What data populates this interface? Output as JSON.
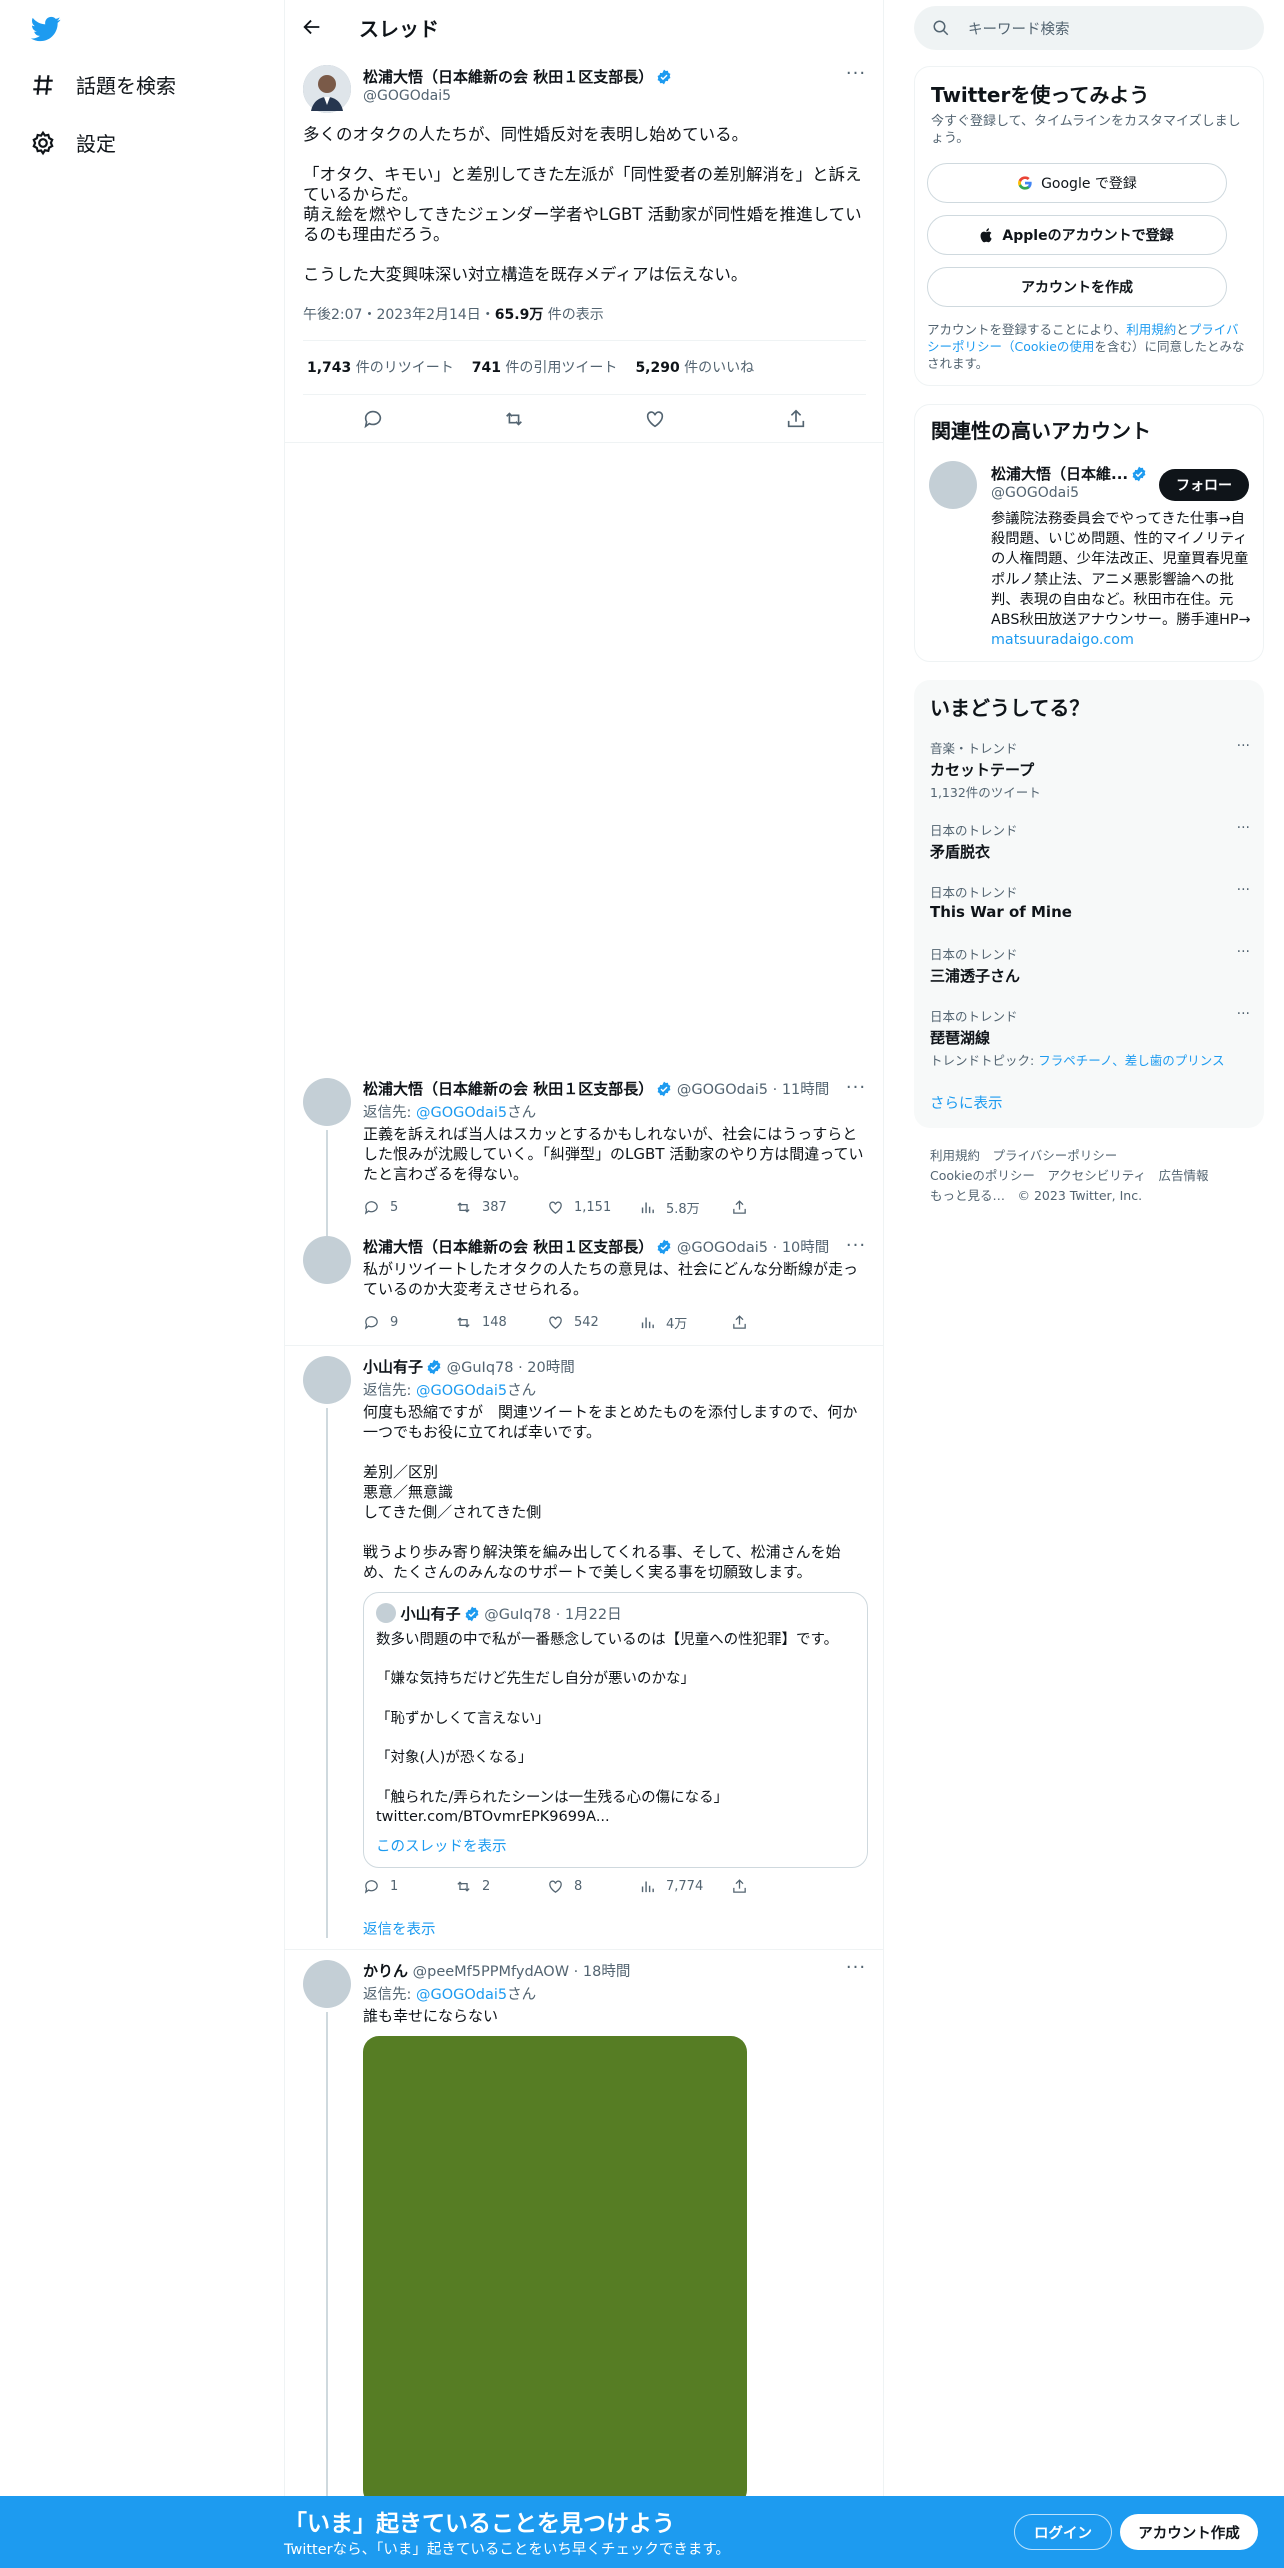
{
  "nav": {
    "explore_label": "話題を検索",
    "settings_label": "設定"
  },
  "header": {
    "title": "スレッド"
  },
  "focus_tweet": {
    "name": "松浦大悟（日本維新の会 秋田１区支部長）",
    "handle": "@GOGOdai5",
    "paragraphs": [
      "多くのオタクの人たちが、同性婚反対を表明し始めている。",
      "「オタク、キモい」と差別してきた左派が「同性愛者の差別解消を」と訴えているからだ。\n萌え絵を燃やしてきたジェンダー学者やLGBT 活動家が同性婚を推進しているのも理由だろう。",
      "こうした大変興味深い対立構造を既存メディアは伝えない。"
    ],
    "time": "午後2:07・2023年2月14日・",
    "views_count": "65.9万",
    "views_label": " 件の表示",
    "retweets_count": "1,743",
    "retweets_label": " 件のリツイート",
    "quotes_count": "741",
    "quotes_label": " 件の引用ツイート",
    "likes_count": "5,290",
    "likes_label": " 件のいいね"
  },
  "replies": [
    {
      "name": "松浦大悟（日本維新の会 秋田１区支部長）",
      "handle_time": "@GOGOdai5 · 11時間",
      "reply_to_prefix": "返信先: ",
      "reply_to_handle": "@GOGOdai5",
      "reply_to_suffix": "さん",
      "text": "正義を訴えれば当人はスカッとするかもしれないが、社会にはうっすらとした恨みが沈殿していく。「糾弾型」のLGBT 活動家のやり方は間違っていたと言わざるを得ない。",
      "replies": "5",
      "retweets": "387",
      "likes": "1,151",
      "views": "5.8万"
    },
    {
      "name": "松浦大悟（日本維新の会 秋田１区支部長）",
      "handle_time": "@GOGOdai5 · 10時間",
      "text": "私がリツイートしたオタクの人たちの意見は、社会にどんな分断線が走っているのか大変考えさせられる。",
      "replies": "9",
      "retweets": "148",
      "likes": "542",
      "views": "4万"
    },
    {
      "name": "小山有子",
      "handle_time": "@GuIq78 · 20時間",
      "reply_to_prefix": "返信先: ",
      "reply_to_handle": "@GOGOdai5",
      "reply_to_suffix": "さん",
      "text": "何度も恐縮ですが　関連ツイートをまとめたものを添付しますので、何か一つでもお役に立てれば幸いです。\n\n差別／区別\n悪意／無意識\nしてきた側／されてきた側\n\n戦うより歩み寄り解決策を編み出してくれる事、そして、松浦さんを始め、たくさんのみんなのサポートで美しく実る事を切願致します。",
      "quote": {
        "name": "小山有子",
        "handle_time": "@GuIq78 · 1月22日",
        "text": "数多い問題の中で私が一番懸念しているのは【児童への性犯罪】です。\n\n「嫌な気持ちだけど先生だし自分が悪いのかな」\n\n「恥ずかしくて言えない」\n\n「対象(人)が恐くなる」\n\n「触られた/弄られたシーンは一生残る心の傷になる」\ntwitter.com/BTOvmrEPK9699A...",
        "show_thread": "このスレッドを表示"
      },
      "replies": "1",
      "retweets": "2",
      "likes": "8",
      "views": "7,774",
      "show_replies": "返信を表示"
    },
    {
      "name": "かりん",
      "handle_time": "@peeMf5PPMfydAOW · 18時間",
      "reply_to_prefix": "返信先: ",
      "reply_to_handle": "@GOGOdai5",
      "reply_to_suffix": "さん",
      "text": "誰も幸せにならない",
      "image_color": "#567d24"
    }
  ],
  "sidebar": {
    "search_placeholder": "キーワード検索",
    "signup_card": {
      "title": "Twitterを使ってみよう",
      "subtitle": "今すぐ登録して、タイムラインをカスタマイズしましょう。",
      "google_button": "Google で登録",
      "apple_button": "Appleのアカウントで登録",
      "create_button": "アカウントを作成",
      "terms_1": "アカウントを登録することにより、",
      "terms_link1": "利用規約",
      "terms_2": "と",
      "terms_link2": "プライバシーポリシー（Cookieの使用",
      "terms_3": "を含む）に同意したとみなされます。"
    },
    "relevant": {
      "title": "関連性の高いアカウント",
      "name": "松浦大悟（日本維...",
      "handle": "@GOGOdai5",
      "follow_label": "フォロー",
      "bio": "参議院法務委員会でやってきた仕事→自殺問題、いじめ問題、性的マイノリティの人権問題、少年法改正、児童買春児童ポルノ禁止法、アニメ悪影響論への批判、表現の自由など。秋田市在住。元ABS秋田放送アナウンサー。勝手連HP→ ",
      "bio_link": "matsuuradaigo.com"
    },
    "trends": {
      "title": "いまどうしてる？",
      "items": [
        {
          "category": "音楽・トレンド",
          "topic": "カセットテープ",
          "sub": "1,132件のツイート"
        },
        {
          "category": "日本のトレンド",
          "topic": "矛盾脱衣",
          "sub": ""
        },
        {
          "category": "日本のトレンド",
          "topic": "This War of Mine",
          "sub": ""
        },
        {
          "category": "日本のトレンド",
          "topic": "三浦透子さん",
          "sub": ""
        },
        {
          "category": "日本のトレンド",
          "topic": "琵琶湖線",
          "sub": ""
        }
      ],
      "last_trend_prefix": "トレンドトピック: ",
      "last_trend_links": "フラペチーノ、差し歯のプリンス",
      "show_more": "さらに表示"
    },
    "footer": {
      "line1": "利用規約　プライバシーポリシー",
      "line2": "Cookieのポリシー　アクセシビリティ　広告情報",
      "line3": "もっと見る…　© 2023 Twitter, Inc."
    }
  },
  "bottom_bar": {
    "title": "「いま」起きていることを見つけよう",
    "subtitle": "Twitterなら、「いま」起きていることをいち早くチェックできます。",
    "login": "ログイン",
    "signup": "アカウント作成"
  },
  "colors": {
    "accent": "#1d9bf0",
    "bottom_bar": "#1d9bf0"
  }
}
